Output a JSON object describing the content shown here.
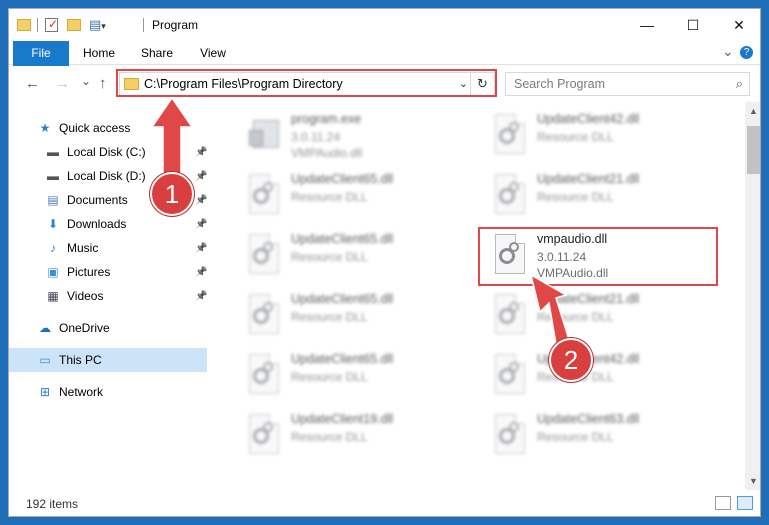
{
  "window": {
    "title": "Program",
    "controls": {
      "minimize": "—",
      "maximize": "☐",
      "close": "✕"
    }
  },
  "ribbon": {
    "tabs": [
      "File",
      "Home",
      "Share",
      "View"
    ],
    "expand_icon": "chevron-down-icon",
    "help_icon": "help-icon",
    "help_glyph": "?",
    "expand_glyph": "⌄"
  },
  "nav": {
    "back": "←",
    "forward": "→",
    "recent": "⌄",
    "up": "↑",
    "address": "C:\\Program Files\\Program Directory",
    "dropdown": "⌄",
    "refresh": "↻",
    "search_placeholder": "Search Program",
    "search_glyph": "⌕"
  },
  "sidebar": {
    "items": [
      {
        "label": "Quick access",
        "icon": "★",
        "icon_name": "star-icon",
        "pinned": false
      },
      {
        "label": "Local Disk (C:)",
        "icon": "▬",
        "icon_name": "drive-icon",
        "pinned": true,
        "pin": "📌"
      },
      {
        "label": "Local Disk (D:)",
        "icon": "▬",
        "icon_name": "drive-icon",
        "pinned": true,
        "pin": "📌"
      },
      {
        "label": "Documents",
        "icon": "▤",
        "icon_name": "documents-icon",
        "pinned": true,
        "pin": "📌"
      },
      {
        "label": "Downloads",
        "icon": "⬇",
        "icon_name": "downloads-icon",
        "pinned": true,
        "pin": "📌"
      },
      {
        "label": "Music",
        "icon": "♪",
        "icon_name": "music-icon",
        "pinned": true,
        "pin": "📌"
      },
      {
        "label": "Pictures",
        "icon": "▣",
        "icon_name": "pictures-icon",
        "pinned": true,
        "pin": "📌"
      },
      {
        "label": "Videos",
        "icon": "▦",
        "icon_name": "videos-icon",
        "pinned": true,
        "pin": "📌"
      },
      {
        "label": "OneDrive",
        "icon": "☁",
        "icon_name": "cloud-icon",
        "pinned": false
      },
      {
        "label": "This PC",
        "icon": "▭",
        "icon_name": "computer-icon",
        "pinned": false,
        "selected": true
      },
      {
        "label": "Network",
        "icon": "⊞",
        "icon_name": "network-icon",
        "pinned": false
      }
    ]
  },
  "files": [
    {
      "name": "program.exe",
      "line1": "3.0.11.24",
      "line2": "VMPAudio.dll",
      "kind": "exe",
      "blurred": true
    },
    {
      "name": "UpdateClient42.dll",
      "line1": "Resource DLL",
      "line2": "",
      "kind": "dll",
      "blurred": true
    },
    {
      "name": "UpdateClient65.dll",
      "line1": "Resource DLL",
      "line2": "",
      "kind": "dll",
      "blurred": true
    },
    {
      "name": "UpdateClient21.dll",
      "line1": "Resource DLL",
      "line2": "",
      "kind": "dll",
      "blurred": true
    },
    {
      "name": "UpdateClient65.dll",
      "line1": "Resource DLL",
      "line2": "",
      "kind": "dll",
      "blurred": true
    },
    {
      "name": "vmpaudio.dll",
      "line1": "3.0.11.24",
      "line2": "VMPAudio.dll",
      "kind": "dll",
      "blurred": false,
      "highlighted": true
    },
    {
      "name": "UpdateClient65.dll",
      "line1": "Resource DLL",
      "line2": "",
      "kind": "dll",
      "blurred": true
    },
    {
      "name": "UpdateClient21.dll",
      "line1": "Resource DLL",
      "line2": "",
      "kind": "dll",
      "blurred": true
    },
    {
      "name": "UpdateClient65.dll",
      "line1": "Resource DLL",
      "line2": "",
      "kind": "dll",
      "blurred": true
    },
    {
      "name": "UpdateClient42.dll",
      "line1": "Resource DLL",
      "line2": "",
      "kind": "dll",
      "blurred": true
    },
    {
      "name": "UpdateClient19.dll",
      "line1": "Resource DLL",
      "line2": "",
      "kind": "dll",
      "blurred": true
    },
    {
      "name": "UpdateClient63.dll",
      "line1": "Resource DLL",
      "line2": "",
      "kind": "dll",
      "blurred": true
    }
  ],
  "status": {
    "count": "192 items"
  },
  "annotations": {
    "step1": "1",
    "step2": "2",
    "highlight_color": "#e04848",
    "arrow_color": "#e04848"
  }
}
